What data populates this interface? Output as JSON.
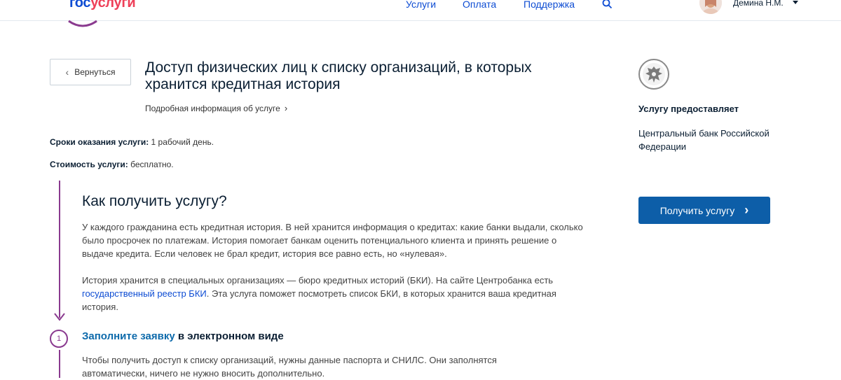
{
  "header": {
    "logo_part1": "гос",
    "logo_part2": "услуги",
    "nav": [
      "Услуги",
      "Оплата",
      "Поддержка"
    ],
    "user_name": "Демина Н.М."
  },
  "page": {
    "back_label": "Вернуться",
    "title": "Доступ физических лиц к списку организаций, в которых хранится кредитная история",
    "more_link": "Подробная информация об услуге",
    "term_label": "Сроки оказания услуги:",
    "term_value": " 1 рабочий день.",
    "cost_label": "Стоимость услуги:",
    "cost_value": " бесплатно."
  },
  "how": {
    "title": "Как получить услугу?",
    "para1": "У каждого гражданина есть кредитная история. В ней хранится информация о кредитах: какие банки выдали, сколько было просрочек по платежам. История помогает банкам оценить потенциального клиента и принять решение о выдаче кредита. Если человек не брал кредит, история все равно есть, но «нулевая».",
    "para2_before": "История хранится в специальных организациях — бюро кредитных историй (БКИ). На сайте Центробанка есть ",
    "para2_link": "государственный реестр БКИ",
    "para2_after": ". Эта услуга поможет посмотреть список БКИ, в которых хранится ваша кредитная история."
  },
  "step1": {
    "number": "1",
    "title_link": "Заполните заявку",
    "title_rest": " в электронном виде",
    "text": "Чтобы получить доступ к списку организаций, нужны данные паспорта и СНИЛС. Они заполнятся автоматически, ничего не нужно вносить дополнительно."
  },
  "provider": {
    "title": "Услугу предоставляет",
    "name": "Центральный банк Российской Федерации",
    "button_label": "Получить услугу"
  },
  "colors": {
    "accent_purple": "#8a3a8f",
    "brand_blue": "#0d4cd3",
    "button_blue": "#0d5ea8"
  }
}
